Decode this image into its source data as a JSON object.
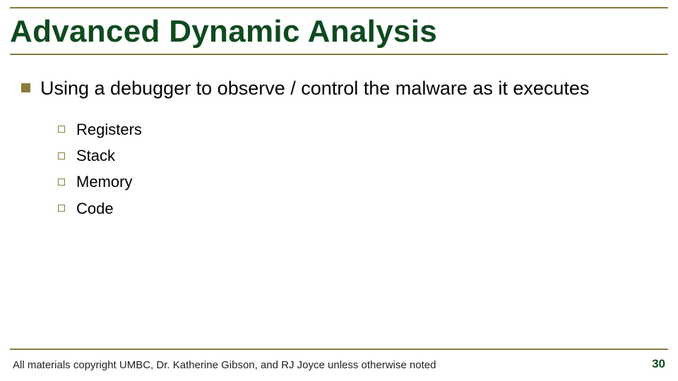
{
  "title": "Advanced Dynamic Analysis",
  "bullet1": "Using a debugger to observe / control the malware as it executes",
  "sub": {
    "a": "Registers",
    "b": "Stack",
    "c": "Memory",
    "d": "Code"
  },
  "footer": "All materials copyright UMBC, Dr. Katherine Gibson, and RJ Joyce unless otherwise noted",
  "page": "30"
}
